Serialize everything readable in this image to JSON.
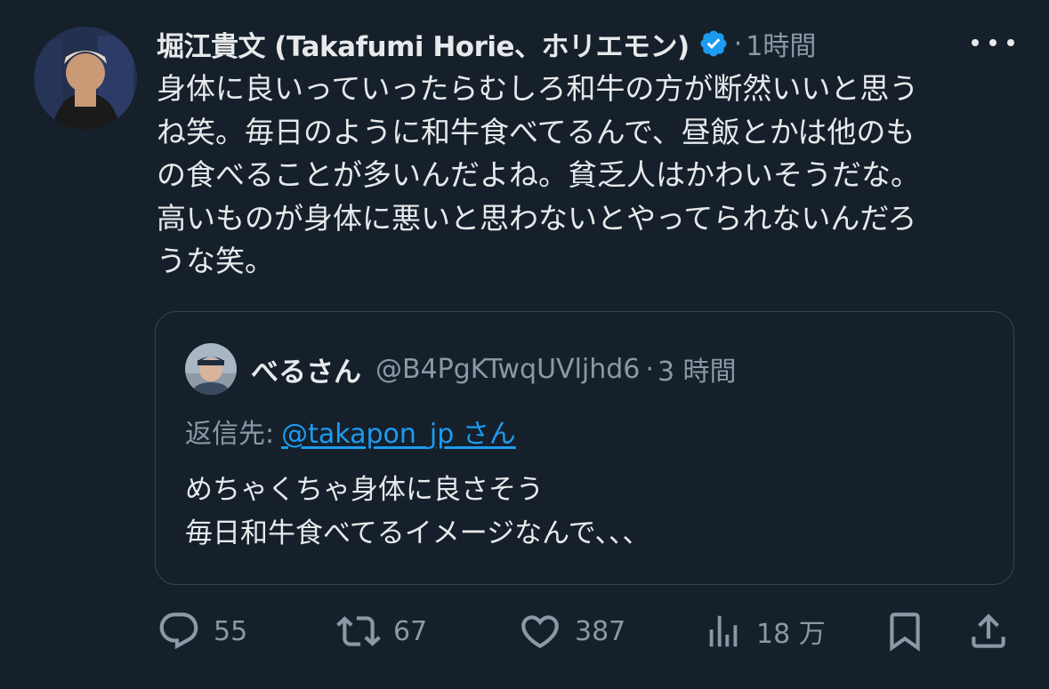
{
  "author": {
    "name": "堀江貴文 (Takafumi Horie、ホリエモン)",
    "verified": true,
    "dot": "·",
    "time": "1時間"
  },
  "tweet": {
    "lines": [
      "身体に良いっていったらむしろ和牛の方が断然いいと思う",
      "ね笑。毎日のように和牛食べてるんで、昼飯とかは他のも",
      "の食べることが多いんだよね。貧乏人はかわいそうだな。",
      "高いものが身体に悪いと思わないとやってられないんだろ",
      "うな笑。"
    ]
  },
  "quote": {
    "name": "べるさん",
    "handle": "@B4PgKTwqUVljhd6",
    "dot": "·",
    "time": "3 時間",
    "reply_prefix": "返信先:",
    "reply_mention": "@takapon_jp さん",
    "lines": [
      "めちゃくちゃ身体に良さそう",
      "毎日和牛食べてるイメージなんで、、、"
    ]
  },
  "actions": {
    "replies": "55",
    "retweets": "67",
    "likes": "387",
    "views": "18 万"
  },
  "colors": {
    "background": "#15202b",
    "text": "#e7e9ea",
    "secondary": "#8b98a5",
    "link": "#1d9bf0",
    "border": "#38444d"
  },
  "icons": [
    "verified-badge-icon",
    "more-icon",
    "reply-icon",
    "retweet-icon",
    "like-icon",
    "views-icon",
    "bookmark-icon",
    "share-icon"
  ]
}
